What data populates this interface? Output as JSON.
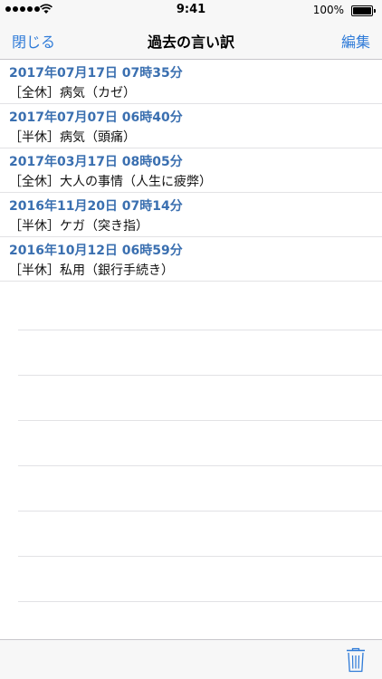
{
  "status_bar": {
    "time": "9:41",
    "battery": "100%"
  },
  "nav": {
    "left_label": "閉じる",
    "title": "過去の言い訳",
    "right_label": "編集"
  },
  "entries": [
    {
      "date": "2017年07月17日 07時35分",
      "reason": "［全休］病気（カゼ）"
    },
    {
      "date": "2017年07月07日 06時40分",
      "reason": "［半休］病気（頭痛）"
    },
    {
      "date": "2017年03月17日 08時05分",
      "reason": "［全休］大人の事情（人生に疲弊）"
    },
    {
      "date": "2016年11月20日 07時14分",
      "reason": "［半休］ケガ（突き指）"
    },
    {
      "date": "2016年10月12日 06時59分",
      "reason": "［半休］私用（銀行手続き）"
    }
  ],
  "toolbar": {
    "trash_icon": "trash-icon"
  },
  "colors": {
    "accent": "#2f7bd8",
    "date_text": "#3a6fb0"
  }
}
